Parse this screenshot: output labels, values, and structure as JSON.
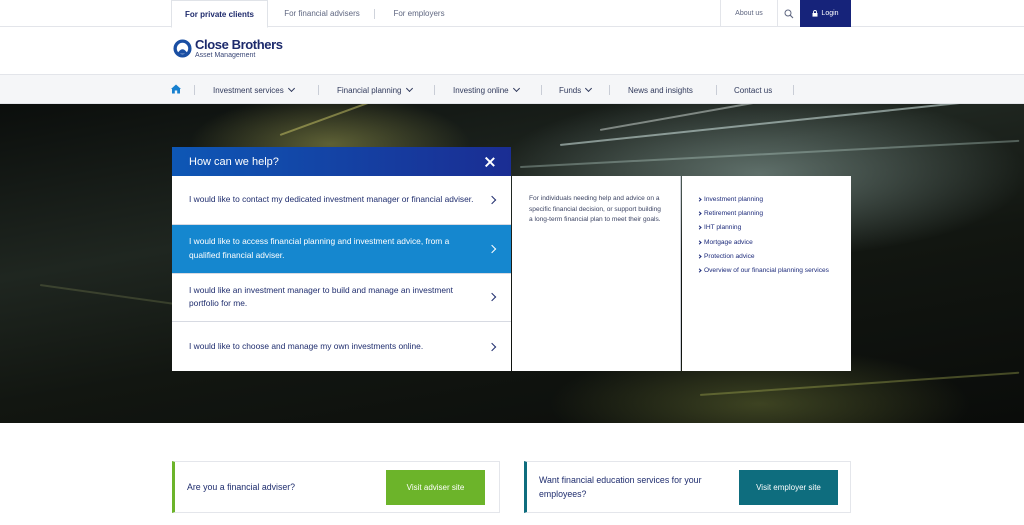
{
  "top_bar": {
    "tabs": [
      {
        "label": "For private clients",
        "active": true
      },
      {
        "label": "For financial advisers",
        "active": false
      },
      {
        "label": "For employers",
        "active": false
      }
    ],
    "about_label": "About us",
    "login_label": "Login"
  },
  "brand": {
    "name": "Close Brothers",
    "subtitle": "Asset Management"
  },
  "nav": {
    "items": [
      {
        "label": "Investment services",
        "has_dropdown": true
      },
      {
        "label": "Financial planning",
        "has_dropdown": true
      },
      {
        "label": "Investing online",
        "has_dropdown": true
      },
      {
        "label": "Funds",
        "has_dropdown": true
      },
      {
        "label": "News and insights",
        "has_dropdown": false
      },
      {
        "label": "Contact us",
        "has_dropdown": false
      }
    ]
  },
  "help_panel": {
    "title": "How can we help?",
    "options": [
      {
        "text": "I would like to contact my dedicated investment manager or financial adviser.",
        "selected": false
      },
      {
        "text": "I would like to access financial planning and investment advice, from a qualified financial adviser.",
        "selected": true
      },
      {
        "text": "I would like an investment manager to build and manage an investment portfolio for me.",
        "selected": false
      },
      {
        "text": "I would like to choose and manage my own investments online.",
        "selected": false
      }
    ],
    "description": "For individuals needing help and advice on a specific financial decision, or support building a long-term financial plan to meet their goals.",
    "links": [
      "Investment planning",
      "Retirement planning",
      "IHT planning",
      "Mortgage advice",
      "Protection advice",
      "Overview of our financial planning services"
    ]
  },
  "cta": {
    "adviser": {
      "text": "Are you a financial adviser?",
      "button": "Visit adviser site"
    },
    "employer": {
      "text": "Want financial education services for your employees?",
      "button": "Visit employer site"
    }
  },
  "colors": {
    "brand_navy": "#16237a",
    "selected_blue": "#1587cf",
    "adviser_green": "#6cb42a",
    "employer_teal": "#0e6d7e"
  }
}
